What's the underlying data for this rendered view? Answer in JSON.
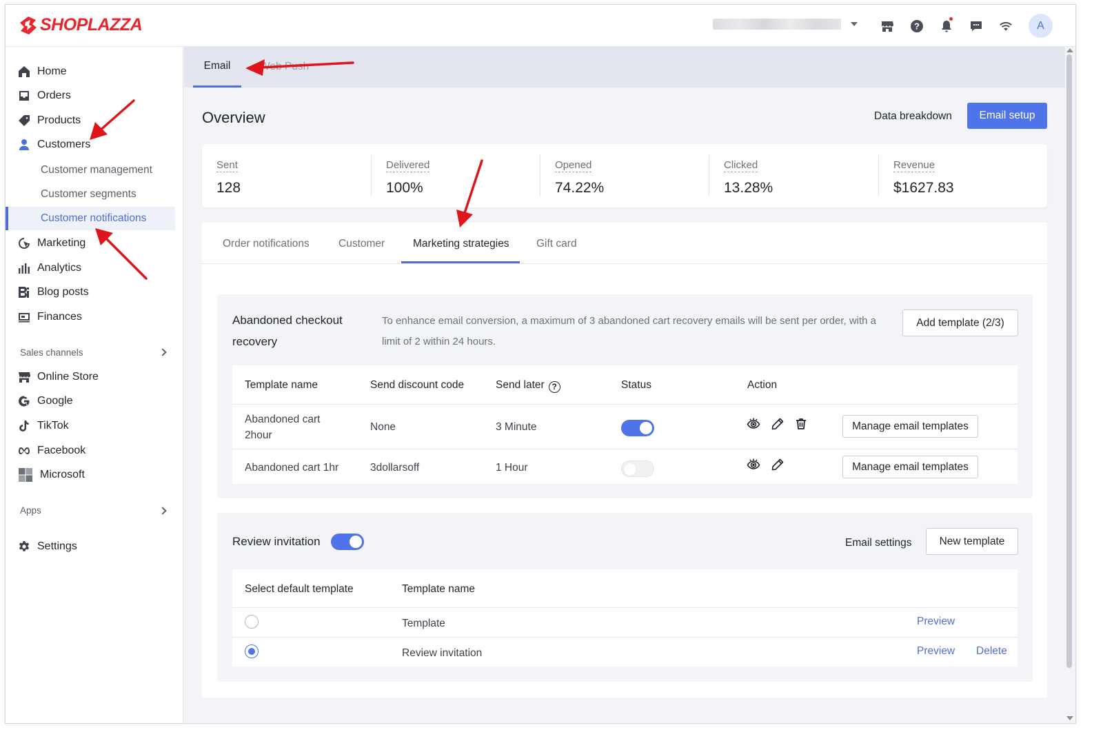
{
  "brand": {
    "name": "SHOPLAZZA",
    "color": "#e8262c"
  },
  "topbar": {
    "icons": [
      "store-icon",
      "help-icon",
      "bell-icon",
      "message-icon",
      "wifi-icon"
    ],
    "avatar_letter": "A"
  },
  "sidebar": {
    "items": [
      {
        "label": "Home",
        "icon": "home-icon"
      },
      {
        "label": "Orders",
        "icon": "orders-icon"
      },
      {
        "label": "Products",
        "icon": "tag-icon"
      },
      {
        "label": "Customers",
        "icon": "person-icon"
      },
      {
        "label": "Marketing",
        "icon": "marketing-icon"
      },
      {
        "label": "Analytics",
        "icon": "chart-icon"
      },
      {
        "label": "Blog posts",
        "icon": "blog-icon"
      },
      {
        "label": "Finances",
        "icon": "finance-icon"
      }
    ],
    "customer_sub": [
      "Customer management",
      "Customer segments",
      "Customer notifications"
    ],
    "sales_channels_label": "Sales channels",
    "channels": [
      {
        "label": "Online Store",
        "icon": "store-icon"
      },
      {
        "label": "Google",
        "icon": "google-icon"
      },
      {
        "label": "TikTok",
        "icon": "tiktok-icon"
      },
      {
        "label": "Facebook",
        "icon": "meta-icon"
      },
      {
        "label": "Microsoft",
        "icon": "microsoft-icon"
      }
    ],
    "apps_label": "Apps",
    "settings_label": "Settings"
  },
  "main": {
    "tabs": [
      "Email",
      "Web Push"
    ],
    "overview_title": "Overview",
    "data_breakdown": "Data breakdown",
    "email_setup": "Email setup",
    "stats": [
      {
        "label": "Sent",
        "value": "128"
      },
      {
        "label": "Delivered",
        "value": "100%"
      },
      {
        "label": "Opened",
        "value": "74.22%"
      },
      {
        "label": "Clicked",
        "value": "13.28%"
      },
      {
        "label": "Revenue",
        "value": "$1627.83"
      }
    ],
    "inner_tabs": [
      "Order notifications",
      "Customer",
      "Marketing strategies",
      "Gift card"
    ],
    "abandoned": {
      "title_line1": "Abandoned checkout",
      "title_line2": "recovery",
      "desc": "To enhance email conversion, a maximum of 3 abandoned cart recovery emails will be sent per order, with a limit of 2 within 24 hours.",
      "add_template": "Add template (2/3)",
      "headers": [
        "Template name",
        "Send discount code",
        "Send later",
        "Status",
        "Action"
      ],
      "rows": [
        {
          "name_line1": "Abandoned cart",
          "name_line2": "2hour",
          "discount": "None",
          "later": "3 Minute",
          "status_on": true,
          "manage": "Manage email templates"
        },
        {
          "name_line1": "Abandoned cart 1hr",
          "name_line2": "",
          "discount": "3dollarsoff",
          "later": "1 Hour",
          "status_on": false,
          "manage": "Manage email templates"
        }
      ]
    },
    "review": {
      "title": "Review invitation",
      "enabled": true,
      "email_settings": "Email settings",
      "new_template": "New template",
      "headers": [
        "Select default template",
        "Template name"
      ],
      "rows": [
        {
          "name": "Template",
          "selected": false,
          "preview": "Preview",
          "delete": ""
        },
        {
          "name": "Review invitation",
          "selected": true,
          "preview": "Preview",
          "delete": "Delete"
        }
      ]
    }
  },
  "accent_color": "#4f73e8"
}
